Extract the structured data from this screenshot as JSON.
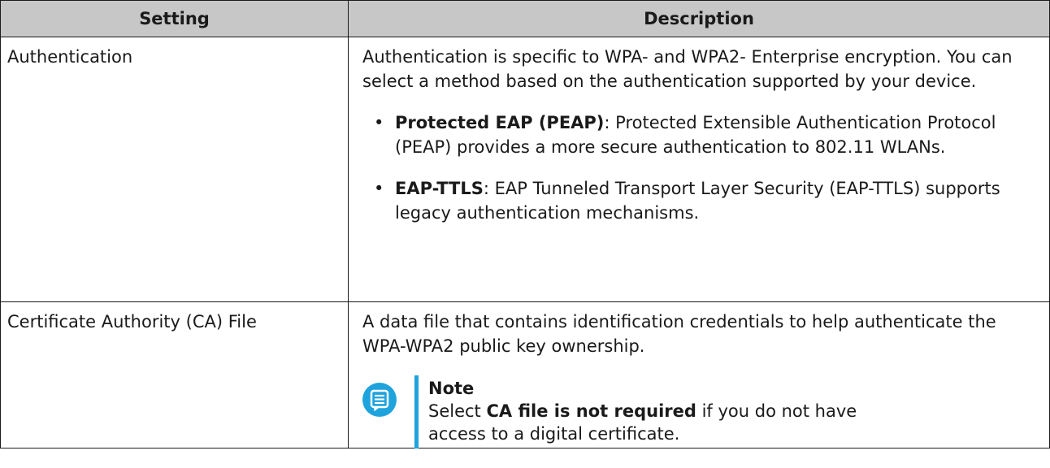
{
  "table": {
    "headers": {
      "setting": "Setting",
      "description": "Description"
    },
    "rows": [
      {
        "setting": "Authentication",
        "description": "Authentication is specific to WPA- and WPA2- Enterprise encryption. You can select a method based on the authentication supported by your device.",
        "options": [
          {
            "term": "Protected EAP (PEAP)",
            "text": ": Protected Extensible Authentication Protocol (PEAP) provides a more secure authentication to 802.11 WLANs."
          },
          {
            "term": "EAP-TTLS",
            "text": ": EAP Tunneled Transport Layer Security (EAP-TTLS) supports legacy authentication mechanisms."
          }
        ]
      },
      {
        "setting": "Certificate Authority (CA) File",
        "description": "A data file that contains identification credentials to help authenticate the WPA-WPA2 public key ownership.",
        "note": {
          "title": "Note",
          "prefix": "Select ",
          "bold": "CA file is not required",
          "suffix_line1": " if you do not have",
          "line2": "access to a digital certificate.",
          "icon": "note-icon",
          "accent_color": "#1fa3dd"
        }
      }
    ]
  }
}
